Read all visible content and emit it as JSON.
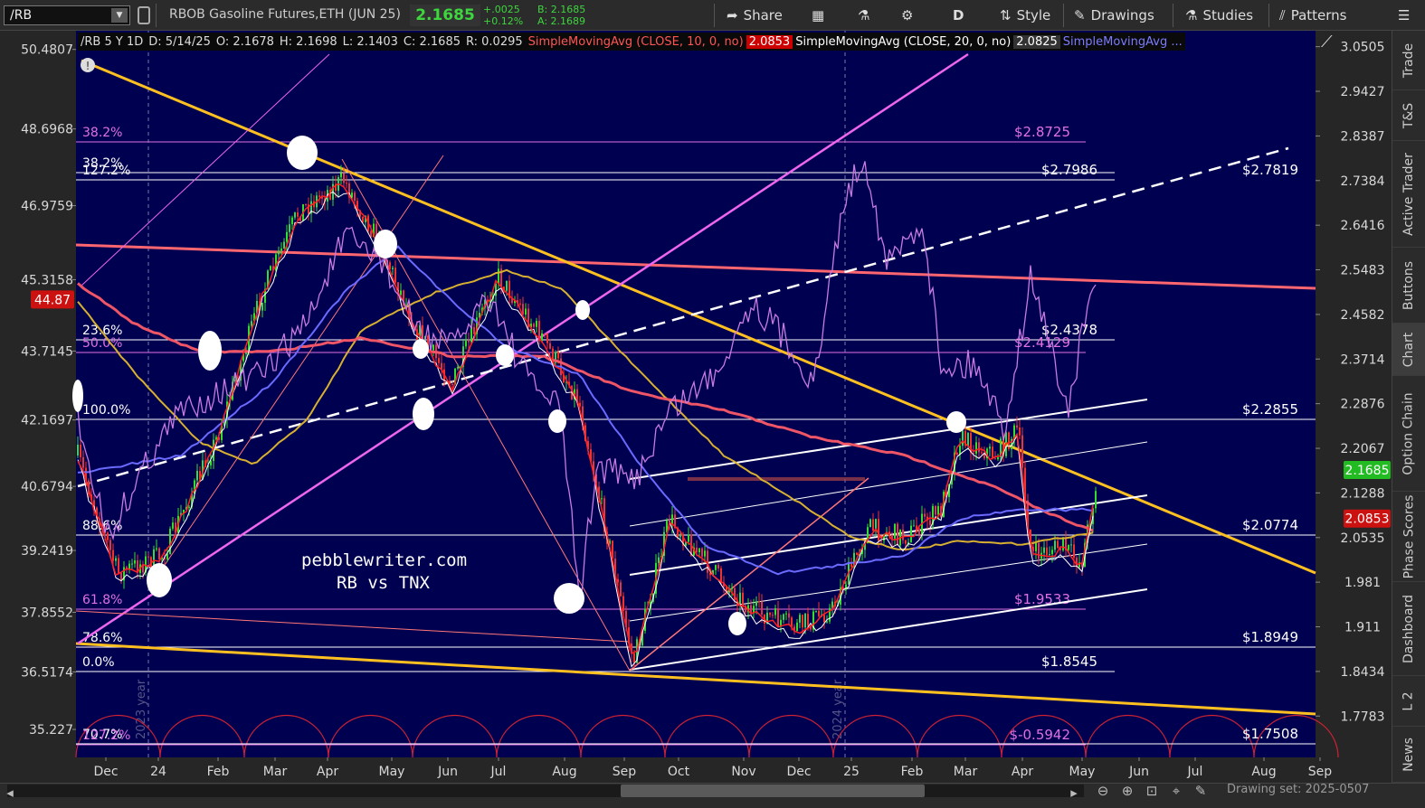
{
  "toolbar": {
    "symbol": "/RB",
    "description": "RBOB Gasoline Futures,ETH (JUN 25)",
    "last": "2.1685",
    "net_change": "+.0025",
    "pct_change": "+0.12%",
    "bid": "B: 2.1685",
    "ask": "A: 2.1689",
    "share": "Share",
    "timeframe": "D",
    "style": "Style",
    "drawings": "Drawings",
    "studies": "Studies",
    "patterns": "Patterns"
  },
  "legend": {
    "header": "/RB 5 Y 1D",
    "date": "D: 5/14/25",
    "open": "O: 2.1678",
    "high": "H: 2.1698",
    "low": "L: 2.1403",
    "close": "C: 2.1685",
    "range": "R: 0.0295",
    "sma10_label": "SimpleMovingAvg (CLOSE, 10, 0, no)",
    "sma10_value": "2.0853",
    "sma20_label": "SimpleMovingAvg (CLOSE, 20, 0, no)",
    "sma20_value": "2.0825",
    "sma50_label": "SimpleMovingAvg ..."
  },
  "right_rail": [
    "Trade",
    "T&S",
    "Active Trader",
    "Buttons",
    "Chart",
    "Option Chain",
    "Phase Scores",
    "Dashboard",
    "L 2",
    "News"
  ],
  "bottom": {
    "drawing_set": "Drawing set: 2025-0507"
  },
  "watermark": {
    "site": "pebblewriter.com",
    "subtitle": "RB vs TNX"
  },
  "year_markers": [
    "2023 year",
    "2024 year"
  ],
  "chart_data": {
    "type": "line",
    "title": "",
    "x_ticks": [
      "Dec",
      "24",
      "Feb",
      "Mar",
      "Apr",
      "May",
      "Jun",
      "Jul",
      "Aug",
      "Sep",
      "Oct",
      "Nov",
      "Dec",
      "25",
      "Feb",
      "Mar",
      "Apr",
      "May",
      "Jun",
      "Jul",
      "Aug",
      "Sep"
    ],
    "right_axis": {
      "label": "RB",
      "ticks": [
        "3.0505",
        "2.9427",
        "2.8387",
        "2.7384",
        "2.6416",
        "2.5483",
        "2.4582",
        "2.3714",
        "2.2876",
        "2.2067",
        "2.1288",
        "2.0535",
        "1.981",
        "1.911",
        "1.8434",
        "1.7783"
      ],
      "ylim": [
        1.72,
        3.09
      ],
      "scale": "log"
    },
    "left_axis": {
      "label": "TNX",
      "ticks": [
        "50.4807",
        "48.6968",
        "46.9759",
        "45.3158",
        "43.7145",
        "42.1697",
        "40.6794",
        "39.2419",
        "37.8552",
        "36.5174",
        "35.227"
      ],
      "ylim": [
        34.6,
        50.9
      ]
    },
    "price_badges": {
      "last": "2.1685",
      "sma10": "2.0853",
      "left_marker": "44.87"
    },
    "fib_levels": [
      {
        "pct": "38.2%",
        "value": "$2.8725",
        "color": "#e070e0"
      },
      {
        "pct": "38.2%",
        "value": "",
        "color": "#ffffff"
      },
      {
        "pct": "127.2%",
        "value": "$2.7986",
        "color": "#ffffff"
      },
      {
        "pct": "23.6%",
        "value": "$2.4378",
        "color": "#ffffff"
      },
      {
        "pct": "50.0%",
        "value": "$2.4129",
        "color": "#e070e0"
      },
      {
        "pct": "100.0%",
        "value": "$2.2855",
        "color": "#ffffff"
      },
      {
        "pct": "88.6%",
        "value": "$2.0774",
        "color": "#ffffff"
      },
      {
        "pct": "61.8%",
        "value": "$1.9533",
        "color": "#e070e0"
      },
      {
        "pct": "78.6%",
        "value": "$1.8949",
        "color": "#ffffff"
      },
      {
        "pct": "0.0%",
        "value": "$1.8545",
        "color": "#ffffff"
      },
      {
        "pct": "70.7%",
        "value": "$1.7508",
        "color": "#ffffff"
      },
      {
        "pct": "127.2%",
        "value": "$-0.5942",
        "color": "#e070e0"
      }
    ],
    "channel_label": "$2.7819",
    "series": [
      {
        "name": "RB",
        "color": "#3ed53e"
      },
      {
        "name": "TNX",
        "color": "#c77be0"
      },
      {
        "name": "SMA 10",
        "color": "#ff3030"
      },
      {
        "name": "SMA 20",
        "color": "#ffffff"
      },
      {
        "name": "SMA 50",
        "color": "#6a6aff"
      }
    ]
  }
}
